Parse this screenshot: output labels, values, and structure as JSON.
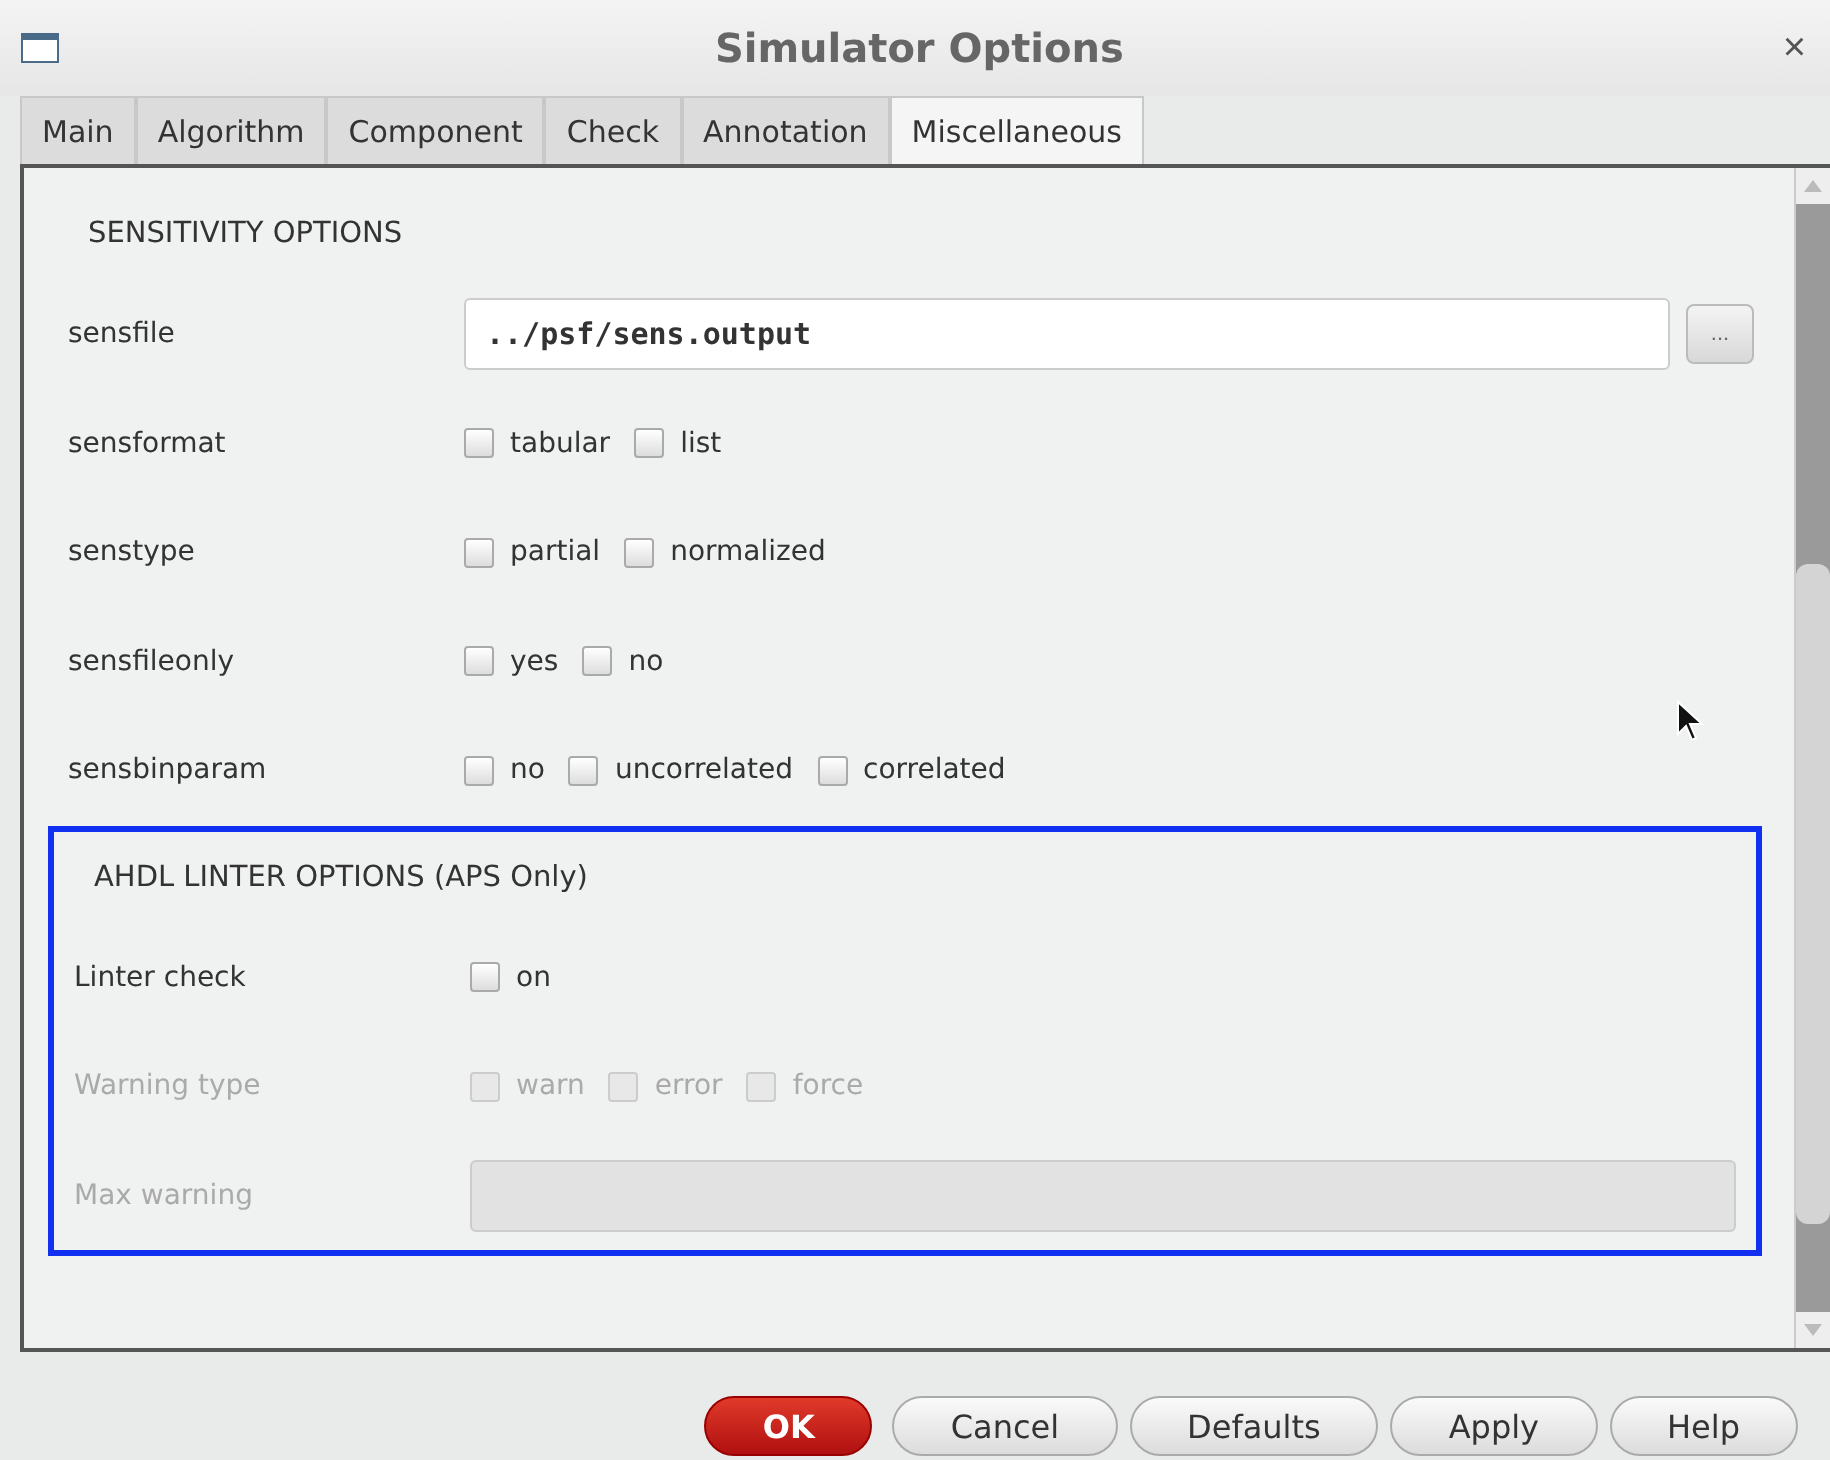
{
  "window": {
    "title": "Simulator Options",
    "close": "×"
  },
  "tabs": [
    {
      "label": "Main",
      "selected": false
    },
    {
      "label": "Algorithm",
      "selected": false
    },
    {
      "label": "Component",
      "selected": false
    },
    {
      "label": "Check",
      "selected": false
    },
    {
      "label": "Annotation",
      "selected": false
    },
    {
      "label": "Miscellaneous",
      "selected": true
    }
  ],
  "sections": [
    {
      "title": "SENSITIVITY OPTIONS",
      "highlighted": false,
      "rows": [
        {
          "label": "sensfile",
          "kind": "file",
          "disabled": false,
          "value": "../psf/sens.output",
          "browse": "..."
        },
        {
          "label": "sensformat",
          "kind": "checks",
          "disabled": false,
          "options": [
            {
              "label": "tabular",
              "checked": false
            },
            {
              "label": "list",
              "checked": false
            }
          ]
        },
        {
          "label": "senstype",
          "kind": "checks",
          "disabled": false,
          "options": [
            {
              "label": "partial",
              "checked": false
            },
            {
              "label": "normalized",
              "checked": false
            }
          ]
        },
        {
          "label": "sensfileonly",
          "kind": "checks",
          "disabled": false,
          "options": [
            {
              "label": "yes",
              "checked": false
            },
            {
              "label": "no",
              "checked": false
            }
          ]
        },
        {
          "label": "sensbinparam",
          "kind": "checks",
          "disabled": false,
          "options": [
            {
              "label": "no",
              "checked": false
            },
            {
              "label": "uncorrelated",
              "checked": false
            },
            {
              "label": "correlated",
              "checked": false
            }
          ]
        }
      ]
    },
    {
      "title": "AHDL LINTER OPTIONS (APS Only)",
      "highlighted": true,
      "rows": [
        {
          "label": "Linter check",
          "kind": "checks",
          "disabled": false,
          "options": [
            {
              "label": "on",
              "checked": false
            }
          ]
        },
        {
          "label": "Warning type",
          "kind": "checks",
          "disabled": true,
          "options": [
            {
              "label": "warn",
              "checked": false
            },
            {
              "label": "error",
              "checked": false
            },
            {
              "label": "force",
              "checked": false
            }
          ]
        },
        {
          "label": "Max warning",
          "kind": "field",
          "disabled": true
        }
      ]
    }
  ],
  "buttons": [
    {
      "label": "OK",
      "primary": true
    },
    {
      "label": "Cancel",
      "primary": false
    },
    {
      "label": "Defaults",
      "primary": false
    },
    {
      "label": "Apply",
      "primary": false
    },
    {
      "label": "Help",
      "primary": false
    }
  ]
}
